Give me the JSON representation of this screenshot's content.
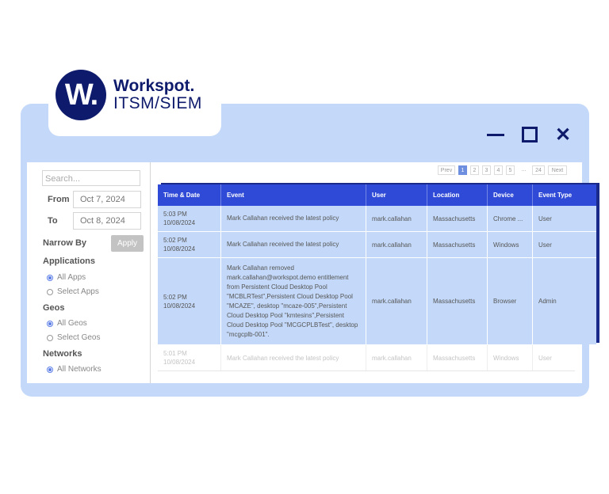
{
  "brand": {
    "logo_letter": "W.",
    "name": "Workspot.",
    "product": "ITSM/SIEM"
  },
  "window_controls": {
    "minimize": "minimize-icon",
    "maximize": "maximize-icon",
    "close": "✕"
  },
  "sidebar": {
    "search_placeholder": "Search...",
    "from_label": "From",
    "from_value": "Oct 7, 2024",
    "to_label": "To",
    "to_value": "Oct 8, 2024",
    "narrow_by": "Narrow By",
    "apply": "Apply",
    "applications": {
      "title": "Applications",
      "options": [
        "All Apps",
        "Select Apps"
      ]
    },
    "geos": {
      "title": "Geos",
      "options": [
        "All Geos",
        "Select Geos"
      ]
    },
    "networks": {
      "title": "Networks",
      "options": [
        "All Networks"
      ]
    }
  },
  "pagination": [
    "Prev",
    "1",
    "2",
    "3",
    "4",
    "5",
    "...",
    "24",
    "Next"
  ],
  "table": {
    "headers": [
      "Time & Date",
      "Event",
      "User",
      "Location",
      "Device",
      "Event Type"
    ],
    "rows": [
      {
        "time": "5:03 PM",
        "date": "10/08/2024",
        "event": "Mark Callahan received the latest policy",
        "user": "mark.callahan",
        "location": "Massachusetts",
        "device": "Chrome ...",
        "type": "User"
      },
      {
        "time": "5:02 PM",
        "date": "10/08/2024",
        "event": "Mark Callahan received the latest policy",
        "user": "mark.callahan",
        "location": "Massachusetts",
        "device": "Windows",
        "type": "User"
      },
      {
        "time": "5:02 PM",
        "date": "10/08/2024",
        "event": "Mark Callahan removed mark.callahan@workspot.demo entitlement from Persistent Cloud Desktop Pool \"MCBLRTest\",Persistent Cloud Desktop Pool \"MCAZE\", desktop \"mcaze-005\",Persistent Cloud Desktop Pool \"kmtesins\",Persistent Cloud Desktop Pool \"MCGCPLBTest\", desktop \"mcgcplb-001\".",
        "user": "mark.callahan",
        "location": "Massachusetts",
        "device": "Browser",
        "type": "Admin"
      },
      {
        "time": "5:01 PM",
        "date": "10/08/2024",
        "event": "Mark Callahan received the latest policy",
        "user": "mark.callahan",
        "location": "Massachusetts",
        "device": "Windows",
        "type": "User"
      }
    ]
  },
  "colors": {
    "frame": "#c4d9f9",
    "header": "#2f4ad6",
    "navy": "#0e1a6b"
  }
}
